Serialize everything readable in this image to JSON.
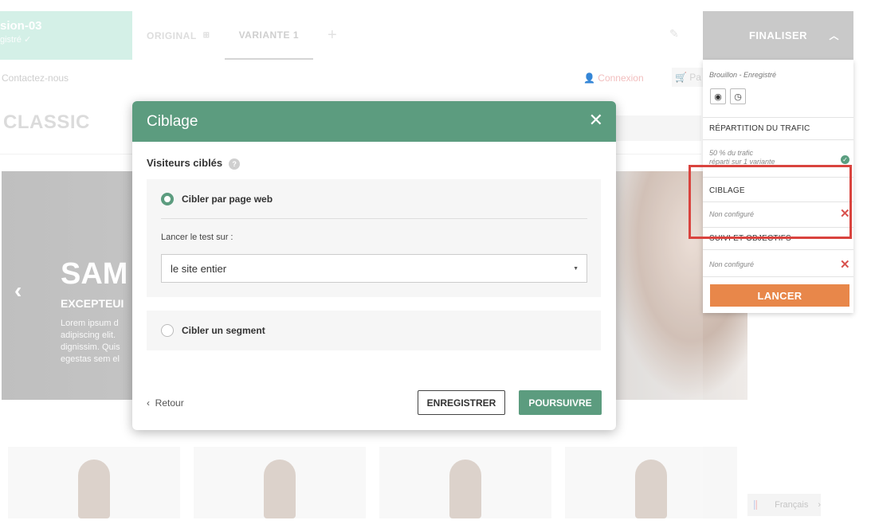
{
  "editor": {
    "campaign_name": "sion-03",
    "campaign_state": "gistré ✓",
    "tabs": [
      {
        "label": "ORIGINAL",
        "badge": "⊞"
      },
      {
        "label": "VARIANTE 1"
      },
      {
        "label": "+"
      }
    ],
    "finalise_label": "FINALISER"
  },
  "site": {
    "nav_contact": "Contactez-nous",
    "nav_login": "Connexion",
    "nav_cart": "Pa",
    "logo": "CLASSIC",
    "hero_title": "SAM",
    "hero_subtitle": "EXCEPTEUI",
    "hero_text": "Lorem ipsum d\nadipiscing elit.\ndignissim. Quis\negestas sem el",
    "language": "Français"
  },
  "panel": {
    "status": "Brouillon - Enregistré",
    "traffic_title": "RÉPARTITION DU TRAFIC",
    "traffic_sub_1": "50 % du trafic",
    "traffic_sub_2": "réparti sur 1 variante",
    "targeting_title": "CIBLAGE",
    "targeting_status": "Non configuré",
    "goals_title": "SUIVI ET OBJECTIFS",
    "goals_status": "Non configuré",
    "launch_label": "LANCER"
  },
  "modal": {
    "title": "Ciblage",
    "section_label": "Visiteurs ciblés",
    "option_webpage": "Cibler par page web",
    "launch_on_label": "Lancer le test sur :",
    "select_value": "le site entier",
    "option_segment": "Cibler un segment",
    "back_label": "Retour",
    "save_label": "ENREGISTRER",
    "continue_label": "POURSUIVRE"
  },
  "colors": {
    "accent_green": "#5c9c7f",
    "launch_orange": "#e8874a",
    "error_red": "#d9534f",
    "highlight_red": "#d9433e"
  }
}
